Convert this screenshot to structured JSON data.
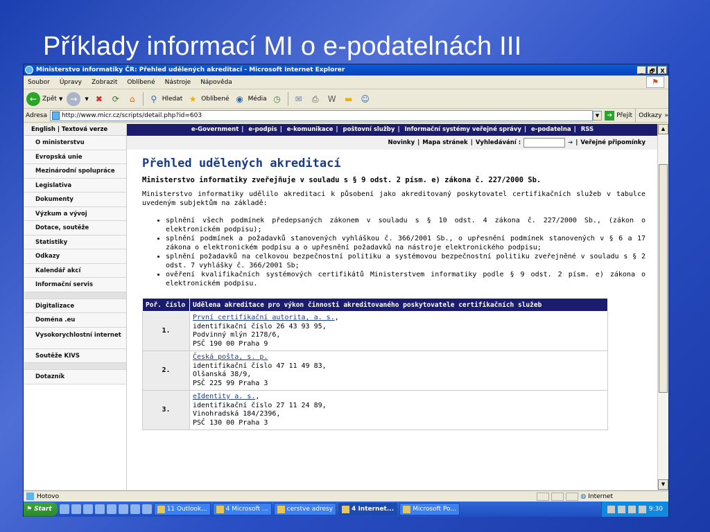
{
  "slide_title": "Příklady informací MI o e-podatelnách III",
  "window": {
    "title": "Ministerstvo informatiky ČR: Přehled udělených akreditací - Microsoft Internet Explorer",
    "controls": [
      "_",
      "🗗",
      "X"
    ]
  },
  "menu": [
    "Soubor",
    "Úpravy",
    "Zobrazit",
    "Oblíbené",
    "Nástroje",
    "Nápověda"
  ],
  "toolbar": {
    "back": "Zpět",
    "search": "Hledat",
    "favorites": "Oblíbené",
    "media": "Média"
  },
  "address": {
    "label": "Adresa",
    "url": "http://www.micr.cz/scripts/detail.php?id=603",
    "go": "Přejít",
    "links": "Odkazy"
  },
  "sidebar": {
    "lang": "English | Textová verze",
    "items": [
      "O ministerstvu",
      "Evropská unie",
      "Mezinárodní spolupráce",
      "Legislativa",
      "Dokumenty",
      "Výzkum a vývoj",
      "Dotace, soutěže",
      "Statistiky",
      "Odkazy",
      "Kalendář akcí",
      "Informační servis"
    ],
    "items2": [
      "Digitalizace",
      "Doména .eu",
      "Vysokorychlostní internet",
      "Soutěže KIVS"
    ],
    "items3": [
      "Dotazník"
    ]
  },
  "topnav": [
    "e-Government",
    "e-podpis",
    "e-komunikace",
    "poštovní služby",
    "Informační systémy veřejné správy",
    "e-podatelna",
    "RSS"
  ],
  "subnav": {
    "news": "Novinky",
    "sitemap": "Mapa stránek",
    "search": "Vyhledávání :",
    "comments": "Veřejné připomínky"
  },
  "page": {
    "heading": "Přehled udělených akreditací",
    "subheading": "Ministerstvo informatiky zveřejňuje v souladu s § 9 odst. 2 písm. e) zákona č. 227/2000 Sb.",
    "intro": "Ministerstvo informatiky udělilo akreditaci k působení jako akreditovaný poskytovatel certifikačních služeb v tabulce uvedeným subjektům na základě:",
    "bullets": [
      "splnění všech podmínek předepsaných zákonem v souladu s § 10 odst. 4 zákona č. 227/2000 Sb., (zákon o elektronickém podpisu);",
      "splnění podmínek a požadavků stanovených vyhláškou č. 366/2001 Sb., o upřesnění podmínek stanovených v § 6 a 17 zákona o elektronickém podpisu a o upřesnění požadavků na nástroje elektronického podpisu;",
      "splnění požadavků na celkovou bezpečnostní politiku a systémovou bezpečnostní politiku zveřejněné v souladu s § 2 odst. 7 vyhlášky č. 366/2001 Sb;",
      "ověření kvalifikačních systémových certifikátů Ministerstvem informatiky podle § 9 odst. 2 písm. e) zákona o elektronickém podpisu."
    ]
  },
  "table": {
    "headers": [
      "Poř. číslo",
      "Udělena akreditace pro výkon činnosti akreditovaného poskytovatele certifikačních služeb"
    ],
    "rows": [
      {
        "num": "1.",
        "name": "První certifikační autorita, a. s.",
        "comma": ",",
        "id": "identifikační číslo 26 43 93 95,",
        "street": "Podvinný mlýn 2178/6,",
        "city": "PSČ 190 00 Praha 9"
      },
      {
        "num": "2.",
        "name": "Česká pošta, s. p.",
        "comma": "",
        "id": "identifikační číslo 47 11 49 83,",
        "street": "Olšanská 38/9,",
        "city": "PSČ 225 99 Praha 3"
      },
      {
        "num": "3.",
        "name": "eIdentity a. s.",
        "comma": ",",
        "id": "identifikační číslo 27 11 24 89,",
        "street": "Vinohradská 184/2396,",
        "city": "PSČ 130 00 Praha 3"
      }
    ]
  },
  "status": {
    "text": "Hotovo",
    "zone": "Internet"
  },
  "taskbar": {
    "start": "Start",
    "tasks": [
      "11 Outlook...",
      "4 Microsoft ...",
      "cerstve adresy",
      "4 Internet...",
      "Microsoft Po..."
    ],
    "clock": "9:30"
  }
}
